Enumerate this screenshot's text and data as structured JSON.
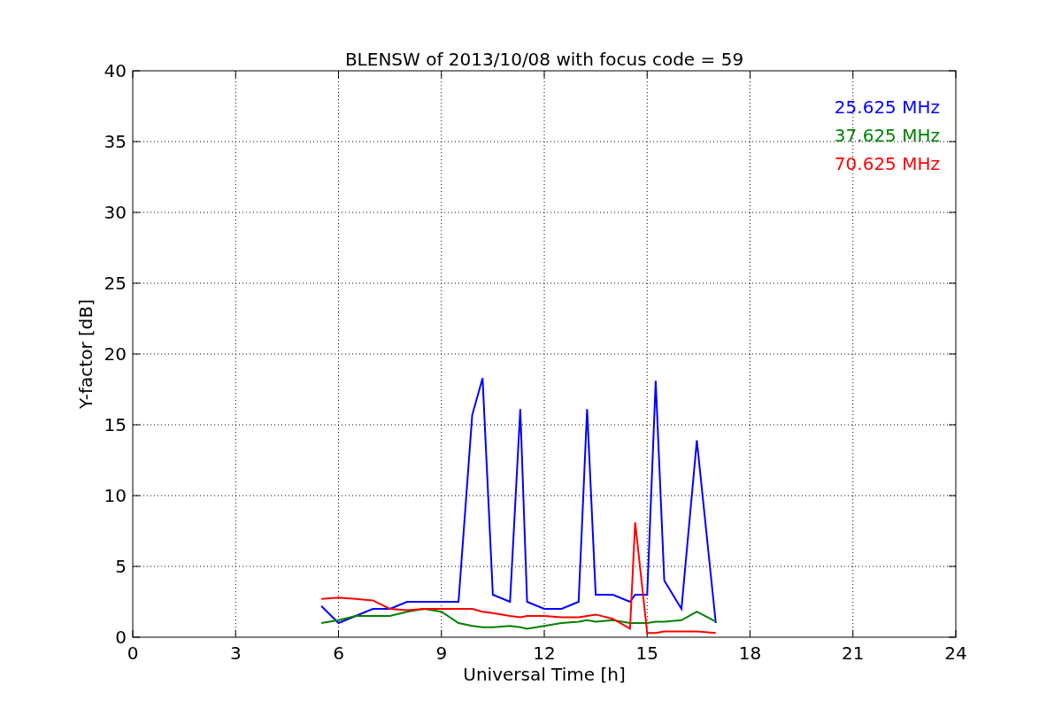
{
  "figure": {
    "chart_data": {
      "type": "line",
      "title": "BLENSW of 2013/10/08 with focus code = 59",
      "xlabel": "Universal Time [h]",
      "ylabel": "Y-factor [dB]",
      "xlim": [
        0,
        24
      ],
      "ylim": [
        0,
        40
      ],
      "xticks": [
        0,
        3,
        6,
        9,
        12,
        15,
        18,
        21,
        24
      ],
      "yticks": [
        0,
        5,
        10,
        15,
        20,
        25,
        30,
        35,
        40
      ],
      "grid": true,
      "x": [
        5.5,
        6,
        6.5,
        7,
        7.5,
        8,
        8.5,
        9,
        9.5,
        9.9,
        10.2,
        10.5,
        11,
        11.3,
        11.5,
        12,
        12.5,
        13,
        13.25,
        13.5,
        14,
        14.5,
        14.65,
        15,
        15.25,
        15.5,
        16,
        16.45,
        17
      ],
      "series": [
        {
          "name": "25.625 MHz",
          "color": "#0000ff",
          "values": [
            2.2,
            1.0,
            1.5,
            2,
            2,
            2.5,
            2.5,
            2.5,
            2.5,
            15.7,
            18.3,
            3,
            2.5,
            16.1,
            2.5,
            2,
            2,
            2.5,
            16.1,
            3,
            3,
            2.5,
            3,
            3,
            18.1,
            4,
            2,
            13.9,
            1
          ]
        },
        {
          "name": "37.625 MHz",
          "color": "#008000",
          "values": [
            1,
            1.2,
            1.5,
            1.5,
            1.5,
            1.8,
            2,
            1.8,
            1,
            0.8,
            0.7,
            0.7,
            0.8,
            0.7,
            0.6,
            0.8,
            1,
            1.1,
            1.2,
            1.1,
            1.2,
            1,
            1,
            1,
            1.1,
            1.1,
            1.2,
            1.8,
            1.1
          ]
        },
        {
          "name": "70.625 MHz",
          "color": "#ff0000",
          "values": [
            2.7,
            2.8,
            2.7,
            2.6,
            2,
            1.9,
            2,
            2,
            2,
            2,
            1.8,
            1.7,
            1.5,
            1.4,
            1.5,
            1.5,
            1.4,
            1.4,
            1.5,
            1.6,
            1.3,
            0.6,
            8.1,
            0.3,
            0.3,
            0.4,
            0.4,
            0.4,
            0.3
          ]
        }
      ]
    }
  }
}
